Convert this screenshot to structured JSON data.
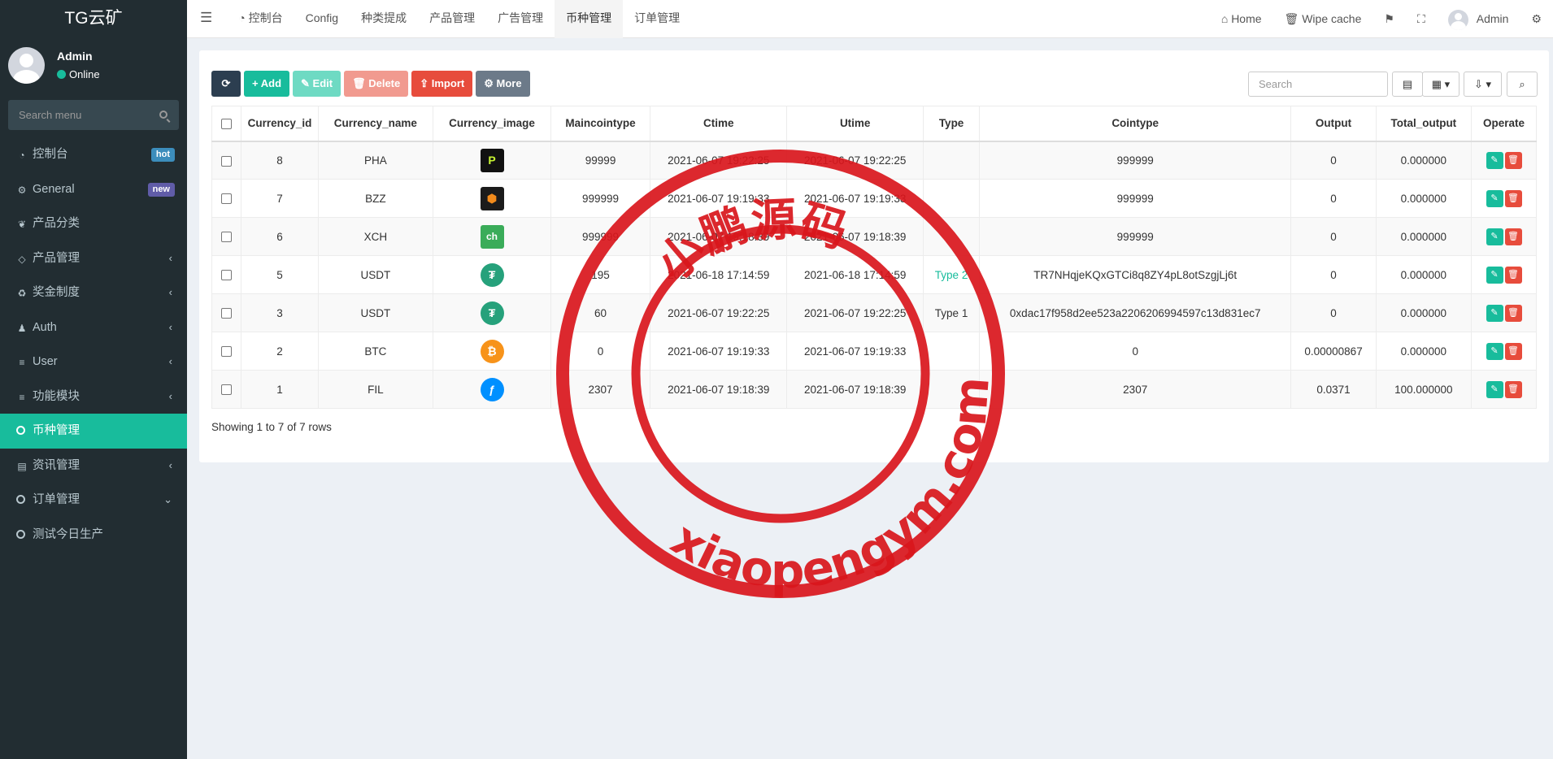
{
  "app": {
    "title": "TG云矿"
  },
  "user": {
    "name": "Admin",
    "status": "Online"
  },
  "sidebar": {
    "search_placeholder": "Search menu",
    "items": [
      {
        "label": "控制台",
        "icon": "dashboard-icon",
        "badge": "hot",
        "badge_color": "#3c8dbc"
      },
      {
        "label": "General",
        "icon": "cogs-icon",
        "badge": "new",
        "badge_color": "#605ca8"
      },
      {
        "label": "产品分类",
        "icon": "leaf-icon"
      },
      {
        "label": "产品管理",
        "icon": "diamond-icon",
        "caret": "‹"
      },
      {
        "label": "奖金制度",
        "icon": "recycle-icon",
        "caret": "‹"
      },
      {
        "label": "Auth",
        "icon": "group-icon",
        "caret": "‹"
      },
      {
        "label": "User",
        "icon": "list-icon",
        "caret": "‹"
      },
      {
        "label": "功能模块",
        "icon": "list-icon",
        "caret": "‹"
      },
      {
        "label": "币种管理",
        "icon": "circle-icon",
        "active": true
      },
      {
        "label": "资讯管理",
        "icon": "newspaper-icon",
        "caret": "‹"
      },
      {
        "label": "订单管理",
        "icon": "circle-icon",
        "caret": "⌄"
      },
      {
        "label": "测试今日生产",
        "icon": "circle-icon"
      }
    ]
  },
  "topnav": {
    "tabs": [
      "控制台",
      "Config",
      "种类提成",
      "产品管理",
      "广告管理",
      "币种管理",
      "订单管理"
    ],
    "active_tab": "币种管理",
    "home_label": "Home",
    "wipe_label": "Wipe cache",
    "admin_label": "Admin"
  },
  "toolbar": {
    "add_label": "Add",
    "edit_label": "Edit",
    "delete_label": "Delete",
    "import_label": "Import",
    "more_label": "More",
    "search_placeholder": "Search"
  },
  "table": {
    "columns": [
      "Currency_id",
      "Currency_name",
      "Currency_image",
      "Maincointype",
      "Ctime",
      "Utime",
      "Type",
      "Cointype",
      "Output",
      "Total_output",
      "Operate"
    ],
    "rows": [
      {
        "id": "8",
        "name": "PHA",
        "image": "pha",
        "maincointype": "99999",
        "ctime": "2021-06-07 19:22:25",
        "utime": "2021-06-07 19:22:25",
        "type": "",
        "cointype": "999999",
        "output": "0",
        "total_output": "0.000000"
      },
      {
        "id": "7",
        "name": "BZZ",
        "image": "bzz",
        "maincointype": "999999",
        "ctime": "2021-06-07 19:19:33",
        "utime": "2021-06-07 19:19:33",
        "type": "",
        "cointype": "999999",
        "output": "0",
        "total_output": "0.000000"
      },
      {
        "id": "6",
        "name": "XCH",
        "image": "chia",
        "maincointype": "999999",
        "ctime": "2021-06-07 19:18:39",
        "utime": "2021-06-07 19:18:39",
        "type": "",
        "cointype": "999999",
        "output": "0",
        "total_output": "0.000000"
      },
      {
        "id": "5",
        "name": "USDT",
        "image": "usdt",
        "maincointype": "195",
        "ctime": "2021-06-18 17:14:59",
        "utime": "2021-06-18 17:14:59",
        "type": "Type 2",
        "cointype": "TR7NHqjeKQxGTCi8q8ZY4pL8otSzgjLj6t",
        "output": "0",
        "total_output": "0.000000"
      },
      {
        "id": "3",
        "name": "USDT",
        "image": "usdt",
        "maincointype": "60",
        "ctime": "2021-06-07 19:22:25",
        "utime": "2021-06-07 19:22:25",
        "type": "Type 1",
        "cointype": "0xdac17f958d2ee523a2206206994597c13d831ec7",
        "output": "0",
        "total_output": "0.000000"
      },
      {
        "id": "2",
        "name": "BTC",
        "image": "btc",
        "maincointype": "0",
        "ctime": "2021-06-07 19:19:33",
        "utime": "2021-06-07 19:19:33",
        "type": "",
        "cointype": "0",
        "output": "0.00000867",
        "total_output": "0.000000"
      },
      {
        "id": "1",
        "name": "FIL",
        "image": "fil",
        "maincointype": "2307",
        "ctime": "2021-06-07 19:18:39",
        "utime": "2021-06-07 19:18:39",
        "type": "",
        "cointype": "2307",
        "output": "0.0371",
        "total_output": "100.000000"
      }
    ]
  },
  "footer": {
    "rows_info": "Showing 1 to 7 of 7 rows"
  },
  "watermark": {
    "top_text": "小鹏源码",
    "bottom_text": "xiaopengym.com",
    "color": "#d9161c"
  },
  "colors": {
    "sidebar_bg": "#222d32",
    "accent": "#18bc9c",
    "danger": "#e74c3c"
  }
}
